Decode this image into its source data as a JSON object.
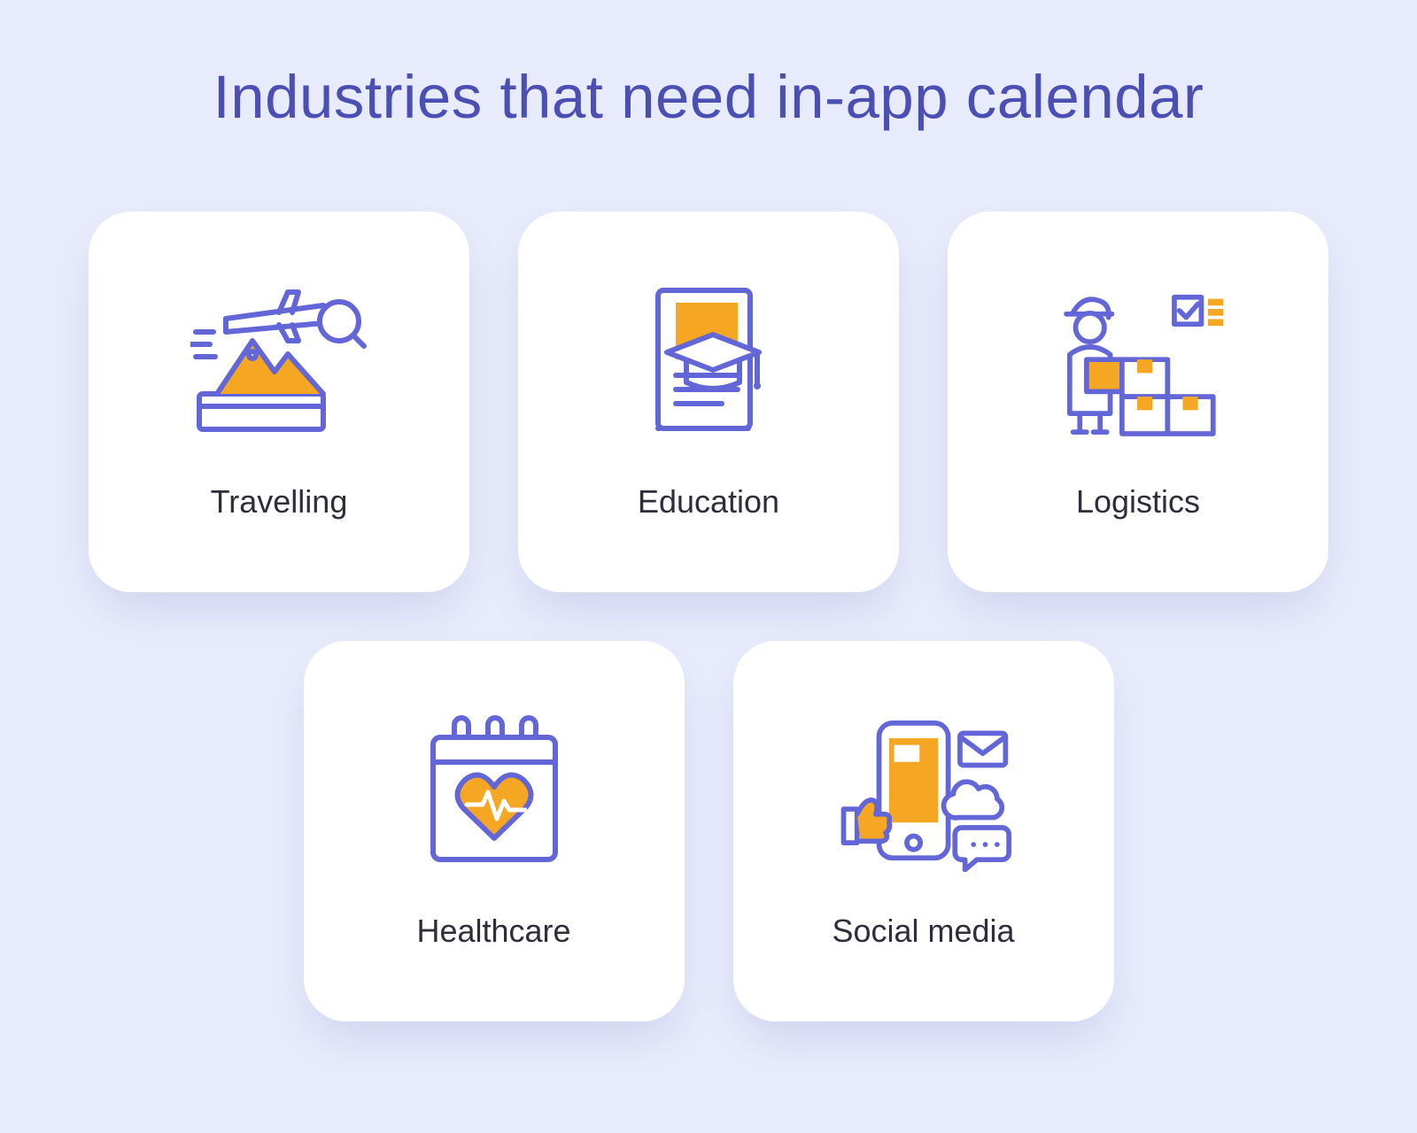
{
  "title": "Industries that need in-app calendar",
  "cards": [
    {
      "label": "Travelling",
      "icon": "travelling-icon"
    },
    {
      "label": "Education",
      "icon": "education-icon"
    },
    {
      "label": "Logistics",
      "icon": "logistics-icon"
    },
    {
      "label": "Healthcare",
      "icon": "healthcare-icon"
    },
    {
      "label": "Social media",
      "icon": "social-media-icon"
    }
  ],
  "colors": {
    "background": "#E8EBFB",
    "card": "#FFFFFF",
    "title": "#4B4FB3",
    "text": "#2E2E3A",
    "iconStroke": "#6366D6",
    "iconAccent": "#F5A623"
  }
}
